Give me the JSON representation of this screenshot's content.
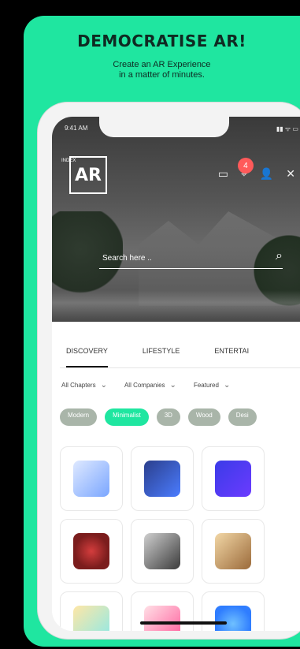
{
  "promo": {
    "headline": "DEMOCRATISE AR!",
    "subline_1": "Create an AR Experience",
    "subline_2": "in a matter of minutes."
  },
  "status": {
    "time": "9:41 AM",
    "right": "▮▮ ᯤ ▭"
  },
  "app": {
    "logo_text": "AR",
    "logo_side_text": "INDEX"
  },
  "header_icons": [
    {
      "name": "message-icon",
      "glyph": "▭"
    },
    {
      "name": "pin-icon",
      "glyph": "⌖",
      "badge": "4"
    },
    {
      "name": "user-icon",
      "glyph": "👤"
    },
    {
      "name": "close-icon",
      "glyph": "✕"
    }
  ],
  "search": {
    "placeholder": "Search here ..",
    "icon": "⌕"
  },
  "tabs": {
    "items": [
      {
        "label": "DISCOVERY"
      },
      {
        "label": "LIFESTYLE"
      },
      {
        "label": "ENTERTAI"
      }
    ]
  },
  "filters": {
    "items": [
      {
        "label": "All Chapters",
        "chevron": "⌄"
      },
      {
        "label": "All Companies",
        "chevron": "⌄"
      },
      {
        "label": "Featured",
        "chevron": "⌄"
      }
    ]
  },
  "chips": {
    "items": [
      {
        "label": "Modern"
      },
      {
        "label": "Minimalist"
      },
      {
        "label": "3D"
      },
      {
        "label": "Wood"
      },
      {
        "label": "Desi"
      }
    ]
  },
  "grid": {
    "tiles": [
      {
        "label": "robot-model"
      },
      {
        "label": "assembly-line-model"
      },
      {
        "label": "tower-model"
      },
      {
        "label": "heart-model"
      },
      {
        "label": "microscope-model"
      },
      {
        "label": "temple-model"
      },
      {
        "label": "cube-model"
      },
      {
        "label": "drone-model"
      },
      {
        "label": "eye-model"
      }
    ]
  }
}
